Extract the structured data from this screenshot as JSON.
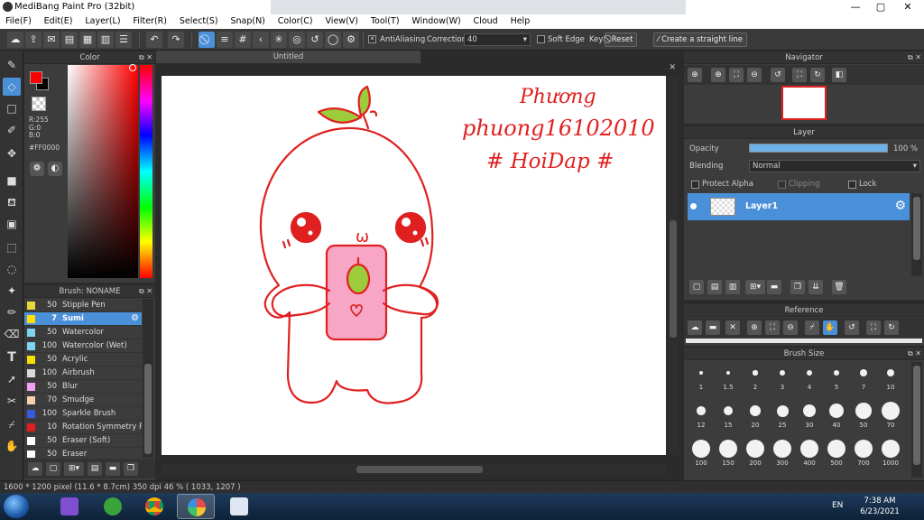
{
  "window": {
    "title": "MediBang Paint Pro (32bit)",
    "controls": {
      "minimize": "—",
      "maximize": "▢",
      "close": "✕"
    }
  },
  "menu": [
    "File(F)",
    "Edit(E)",
    "Layer(L)",
    "Filter(R)",
    "Select(S)",
    "Snap(N)",
    "Color(C)",
    "View(V)",
    "Tool(T)",
    "Window(W)",
    "Cloud",
    "Help"
  ],
  "toolbar": {
    "antialiasing_label": "AntiAliasing",
    "antialiasing_checked": true,
    "correction_label": "Correction",
    "correction_value": "40",
    "soft_edge_label": "Soft Edge",
    "soft_edge_checked": false,
    "key_label": "Key",
    "reset_label": "Reset",
    "straight_line_label": "Create a straight line"
  },
  "color_panel": {
    "title": "Color",
    "foreground": "#ff0000",
    "background": "#000000",
    "rgb_readout": [
      "R:255",
      "G:0",
      "B:0"
    ],
    "hex_readout": "#FF0000"
  },
  "brush_panel": {
    "title": "Brush: NONAME",
    "brushes": [
      {
        "size": "50",
        "name": "Stipple Pen",
        "color": "#e8d93a"
      },
      {
        "size": "7",
        "name": "Sumi",
        "color": "#ffe100",
        "selected": true
      },
      {
        "size": "50",
        "name": "Watercolor",
        "color": "#7fd4f0"
      },
      {
        "size": "100",
        "name": "Watercolor (Wet)",
        "color": "#7fd4f0"
      },
      {
        "size": "50",
        "name": "Acrylic",
        "color": "#f5e000"
      },
      {
        "size": "100",
        "name": "Airbrush",
        "color": "#d9d9d9"
      },
      {
        "size": "50",
        "name": "Blur",
        "color": "#f0a0f0"
      },
      {
        "size": "70",
        "name": "Smudge",
        "color": "#f5d0b0"
      },
      {
        "size": "100",
        "name": "Sparkle Brush",
        "color": "#3a5ae0"
      },
      {
        "size": "10",
        "name": "Rotation Symmetry P",
        "color": "#e02020"
      },
      {
        "size": "50",
        "name": "Eraser (Soft)",
        "color": "#ffffff"
      },
      {
        "size": "50",
        "name": "Eraser",
        "color": "#ffffff"
      }
    ]
  },
  "document": {
    "tab_title": "Untitled",
    "close_glyph": "✕",
    "art_text": [
      "Phương",
      "phuong16102010",
      "# HoiDap #"
    ],
    "face_text": "ω",
    "stroke_color": "#e02020"
  },
  "navigator": {
    "title": "Navigator"
  },
  "layer_panel": {
    "title": "Layer",
    "opacity_label": "Opacity",
    "opacity_value": "100 %",
    "opacity_fraction": 1.0,
    "blending_label": "Blending",
    "blending_value": "Normal",
    "protect_alpha_label": "Protect Alpha",
    "clipping_label": "Clipping",
    "lock_label": "Lock",
    "layers": [
      {
        "name": "Layer1",
        "selected": true
      }
    ]
  },
  "reference": {
    "title": "Reference"
  },
  "brush_size": {
    "title": "Brush Size",
    "sizes": [
      "1",
      "1.5",
      "2",
      "3",
      "4",
      "5",
      "7",
      "10",
      "12",
      "15",
      "20",
      "25",
      "30",
      "40",
      "50",
      "70",
      "100",
      "150",
      "200",
      "300",
      "400",
      "500",
      "700",
      "1000"
    ]
  },
  "status": {
    "text": "1600 * 1200 pixel   (11.6 * 8.7cm)   350 dpi   46 %   ( 1033, 1207 )"
  },
  "taskbar": {
    "language": "EN",
    "time": "7:38 AM",
    "date": "6/23/2021"
  }
}
